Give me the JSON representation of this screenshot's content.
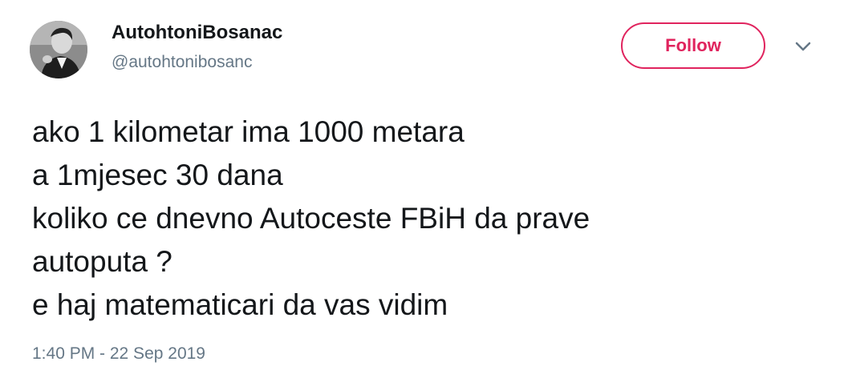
{
  "user": {
    "display_name": "AutohtoniBosanac",
    "handle": "@autohtonibosanc"
  },
  "follow_button": {
    "label": "Follow"
  },
  "menu": {
    "icon": "chevron-down-icon"
  },
  "tweet": {
    "lines": [
      "ako 1 kilometar ima 1000 metara",
      "a 1mjesec 30 dana",
      "koliko ce dnevno Autoceste FBiH da prave",
      "autoputa ?",
      "e haj matematicari da vas vidim"
    ],
    "timestamp": "1:40 PM - 22 Sep 2019"
  },
  "colors": {
    "accent": "#e0245e",
    "text": "#14171a",
    "muted": "#657786"
  }
}
